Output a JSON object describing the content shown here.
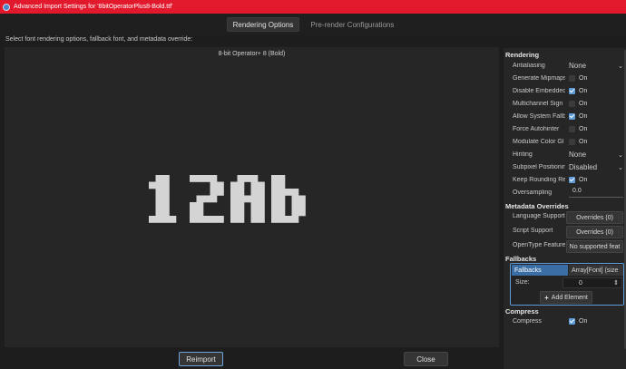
{
  "window": {
    "title": "Advanced Import Settings for '8bitOperatorPlus8-Bold.ttf'"
  },
  "tabs": [
    {
      "label": "Rendering Options",
      "active": true
    },
    {
      "label": "Pre-render Configurations",
      "active": false
    }
  ],
  "instruction": "Select font rendering options, fallback font, and metadata override:",
  "preview": {
    "font_name": "8-bit Operator+ 8 (Bold)",
    "sample_text": "12Ab"
  },
  "buttons": {
    "reimport": "Reimport",
    "close": "Close"
  },
  "inspector": {
    "rendering": {
      "header": "Rendering",
      "antialiasing": {
        "label": "Antialiasing",
        "value": "None"
      },
      "generate_mipmaps": {
        "label": "Generate Mipmaps",
        "checked": false,
        "text": "On"
      },
      "disable_embedded": {
        "label": "Disable Embedded",
        "checked": true,
        "text": "On"
      },
      "multichannel": {
        "label": "Multichannel Sign",
        "checked": false,
        "text": "On"
      },
      "allow_system": {
        "label": "Allow System Fallb",
        "checked": true,
        "text": "On"
      },
      "force_autohinter": {
        "label": "Force Autohinter",
        "checked": false,
        "text": "On"
      },
      "modulate_color": {
        "label": "Modulate Color Gl",
        "checked": false,
        "text": "On"
      },
      "hinting": {
        "label": "Hinting",
        "value": "None"
      },
      "subpixel": {
        "label": "Subpixel Positionin",
        "value": "Disabled"
      },
      "keep_rounding": {
        "label": "Keep Rounding Re",
        "checked": true,
        "text": "On"
      },
      "oversampling": {
        "label": "Oversampling",
        "value": "0.0"
      }
    },
    "metadata": {
      "header": "Metadata Overrides",
      "language": {
        "label": "Language Support",
        "button": "Overrides (0)"
      },
      "script": {
        "label": "Script Support",
        "button": "Overrides (0)"
      },
      "opentype": {
        "label": "OpenType Feature",
        "button": "No supported feat"
      }
    },
    "fallbacks": {
      "header": "Fallbacks",
      "label": "Fallbacks",
      "value": "Array[Font] (size",
      "size_label": "Size:",
      "size_value": "0",
      "add_element": "Add Element"
    },
    "compress": {
      "header": "Compress",
      "label": "Compress",
      "checked": true,
      "text": "On"
    }
  },
  "colors": {
    "titlebar": "#e2182c",
    "accent": "#5e9bd8",
    "preview_glyph": "#d4d4d4"
  }
}
